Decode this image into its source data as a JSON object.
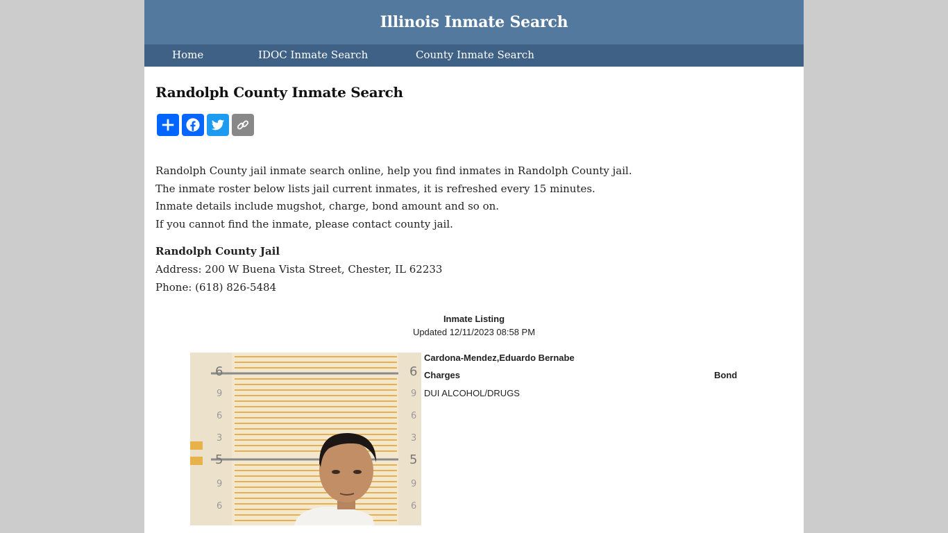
{
  "site": {
    "title": "Illinois Inmate Search"
  },
  "nav": {
    "items": [
      {
        "label": "Home"
      },
      {
        "label": "IDOC Inmate Search"
      },
      {
        "label": "County Inmate Search"
      }
    ]
  },
  "page": {
    "title": "Randolph County Inmate Search",
    "intro_lines": [
      "Randolph County jail inmate search online, help you find inmates in Randolph County jail.",
      "The inmate roster below lists jail current inmates, it is refreshed every 15 minutes.",
      "Inmate details include mugshot, charge, bond amount and so on.",
      "If you cannot find the inmate, please contact county jail."
    ]
  },
  "share": {
    "buttons": [
      {
        "icon": "share-plus-icon",
        "color": "#0166ff"
      },
      {
        "icon": "facebook-icon",
        "color": "#0866ff"
      },
      {
        "icon": "twitter-icon",
        "color": "#1d9bf0"
      },
      {
        "icon": "copy-link-icon",
        "color": "#888888"
      }
    ]
  },
  "jail": {
    "name": "Randolph County Jail",
    "address": "Address: 200 W Buena Vista Street, Chester, IL 62233",
    "phone": "Phone: (618) 826-5484"
  },
  "listing": {
    "title": "Inmate Listing",
    "updated": "Updated 12/11/2023 08:58 PM",
    "inmates": [
      {
        "name": "Cardona-Mendez,Eduardo Bernabe",
        "charges_label": "Charges",
        "bond_label": "Bond",
        "charges": [
          "DUI ALCOHOL/DRUGS"
        ]
      }
    ]
  },
  "colors": {
    "header_bg": "#54799f",
    "nav_bg": "#3f6185",
    "page_bg": "#cccccc"
  }
}
